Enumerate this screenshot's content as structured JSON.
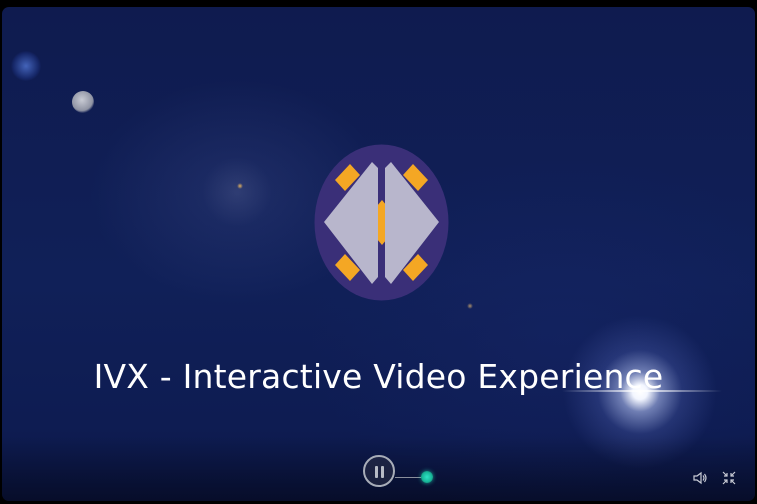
{
  "video": {
    "title": "IVX - Interactive Video Experience",
    "state": "playing"
  },
  "controls": {
    "pause_icon": "pause-icon",
    "progress_node_icon": "interactive-node-icon",
    "volume_icon": "volume-icon",
    "fullscreen_icon": "exit-fullscreen-icon"
  },
  "colors": {
    "background": "#102058",
    "logo_circle": "#3a2f78",
    "logo_shape": "#b8b6cc",
    "logo_accent": "#f4a724",
    "node": "#2fe3c4"
  }
}
